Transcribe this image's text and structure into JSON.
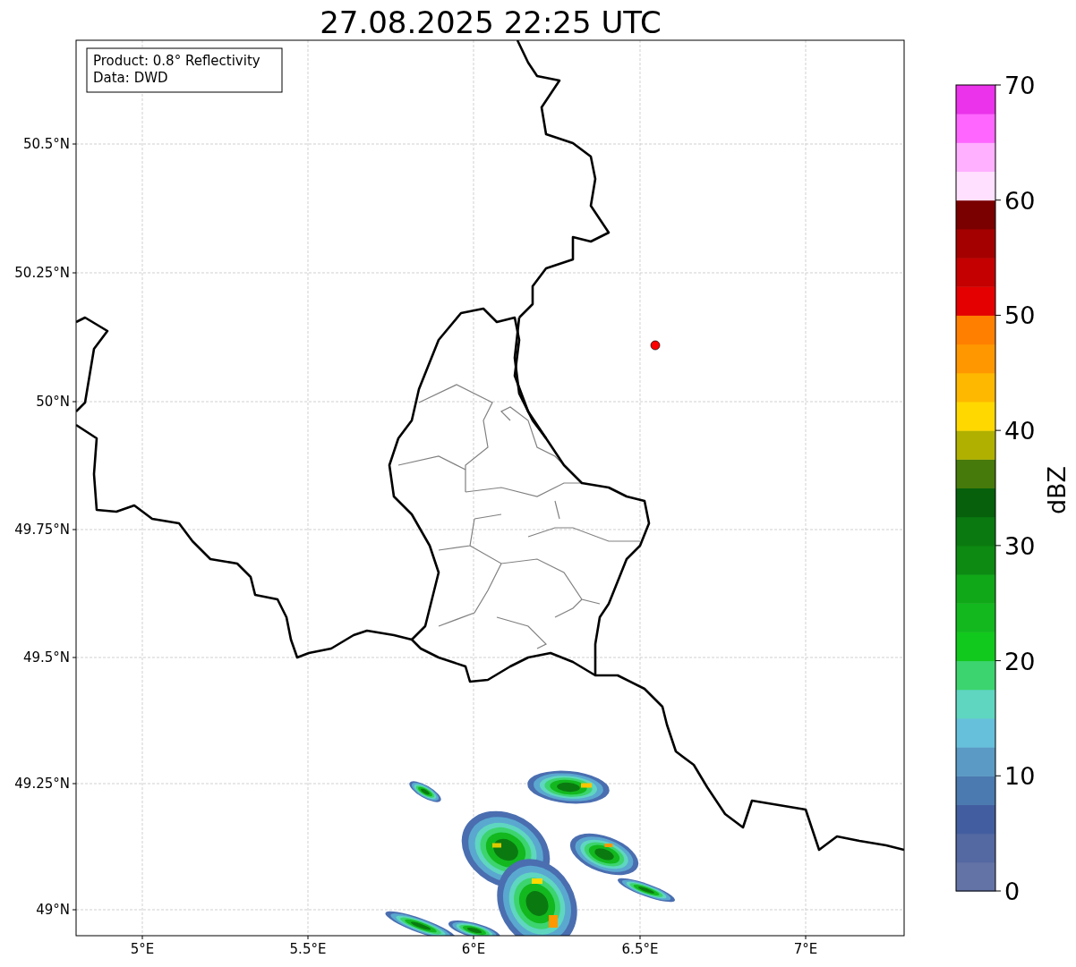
{
  "title": "27.08.2025 22:25 UTC",
  "info_box": [
    "Product: 0.8° Reflectivity",
    "Data: DWD"
  ],
  "map": {
    "x_ticks": [
      "5°E",
      "5.5°E",
      "6°E",
      "6.5°E",
      "7°E"
    ],
    "y_ticks": [
      "50.5°N",
      "50.25°N",
      "50°N",
      "49.75°N",
      "49.5°N",
      "49.25°N",
      "49°N"
    ]
  },
  "colorbar": {
    "label": "dBZ",
    "ticks": [
      "70",
      "60",
      "50",
      "40",
      "30",
      "20",
      "10",
      "0"
    ],
    "bins": [
      {
        "color": "#6473a6"
      },
      {
        "color": "#5468a2"
      },
      {
        "color": "#435ea0"
      },
      {
        "color": "#4a7ab0"
      },
      {
        "color": "#5a9ac4"
      },
      {
        "color": "#66c0dc"
      },
      {
        "color": "#5fd6c0"
      },
      {
        "color": "#3cd46e"
      },
      {
        "color": "#11c81c"
      },
      {
        "color": "#12b81e"
      },
      {
        "color": "#10a818"
      },
      {
        "color": "#0c8a12"
      },
      {
        "color": "#0a7a10"
      },
      {
        "color": "#06600c"
      },
      {
        "color": "#467a0a"
      },
      {
        "color": "#b0b000"
      },
      {
        "color": "#ffd800"
      },
      {
        "color": "#ffb800"
      },
      {
        "color": "#ff9800"
      },
      {
        "color": "#ff7f00"
      },
      {
        "color": "#e40000"
      },
      {
        "color": "#c40000"
      },
      {
        "color": "#a40000"
      },
      {
        "color": "#7a0000"
      },
      {
        "color": "#ffe0ff"
      },
      {
        "color": "#ffb0ff"
      },
      {
        "color": "#ff66ff"
      },
      {
        "color": "#ea33ea"
      }
    ]
  }
}
